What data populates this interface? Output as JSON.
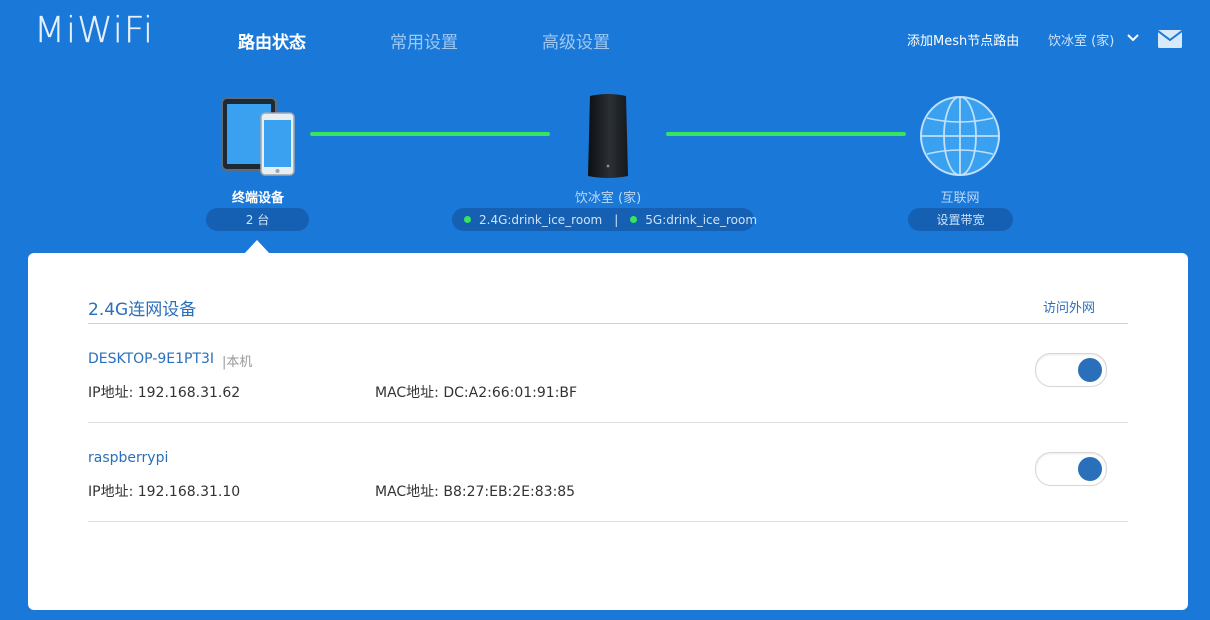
{
  "header": {
    "logo": "MiWiFi",
    "tabs": [
      {
        "label": "路由状态",
        "active": true
      },
      {
        "label": "常用设置",
        "active": false
      },
      {
        "label": "高级设置",
        "active": false
      }
    ],
    "add_mesh": "添加Mesh节点路由",
    "router_select": "饮冰室 (家)",
    "icons": [
      "chevron-down-icon",
      "mail-icon"
    ]
  },
  "topology": {
    "devices": {
      "label": "终端设备",
      "count": "2 台"
    },
    "router": {
      "label": "饮冰室 (家)",
      "ssid_24": "2.4G:drink_ice_room",
      "ssid_5": "5G:drink_ice_room",
      "separator": "|"
    },
    "internet": {
      "label": "互联网",
      "button": "设置带宽"
    },
    "colors": {
      "background": "#1a78d8",
      "link_line": "#39e35e",
      "accent": "#2a6fba"
    }
  },
  "panel": {
    "title": "2.4G连网设备",
    "column_header": "访问外网",
    "devices": [
      {
        "name": "DESKTOP-9E1PT3I",
        "tag": "|本机",
        "ip": "IP地址: 192.168.31.62",
        "mac": "MAC地址: DC:A2:66:01:91:BF",
        "internet_access": true
      },
      {
        "name": "raspberrypi",
        "tag": "",
        "ip": "IP地址: 192.168.31.10",
        "mac": "MAC地址: B8:27:EB:2E:83:85",
        "internet_access": true
      }
    ]
  }
}
